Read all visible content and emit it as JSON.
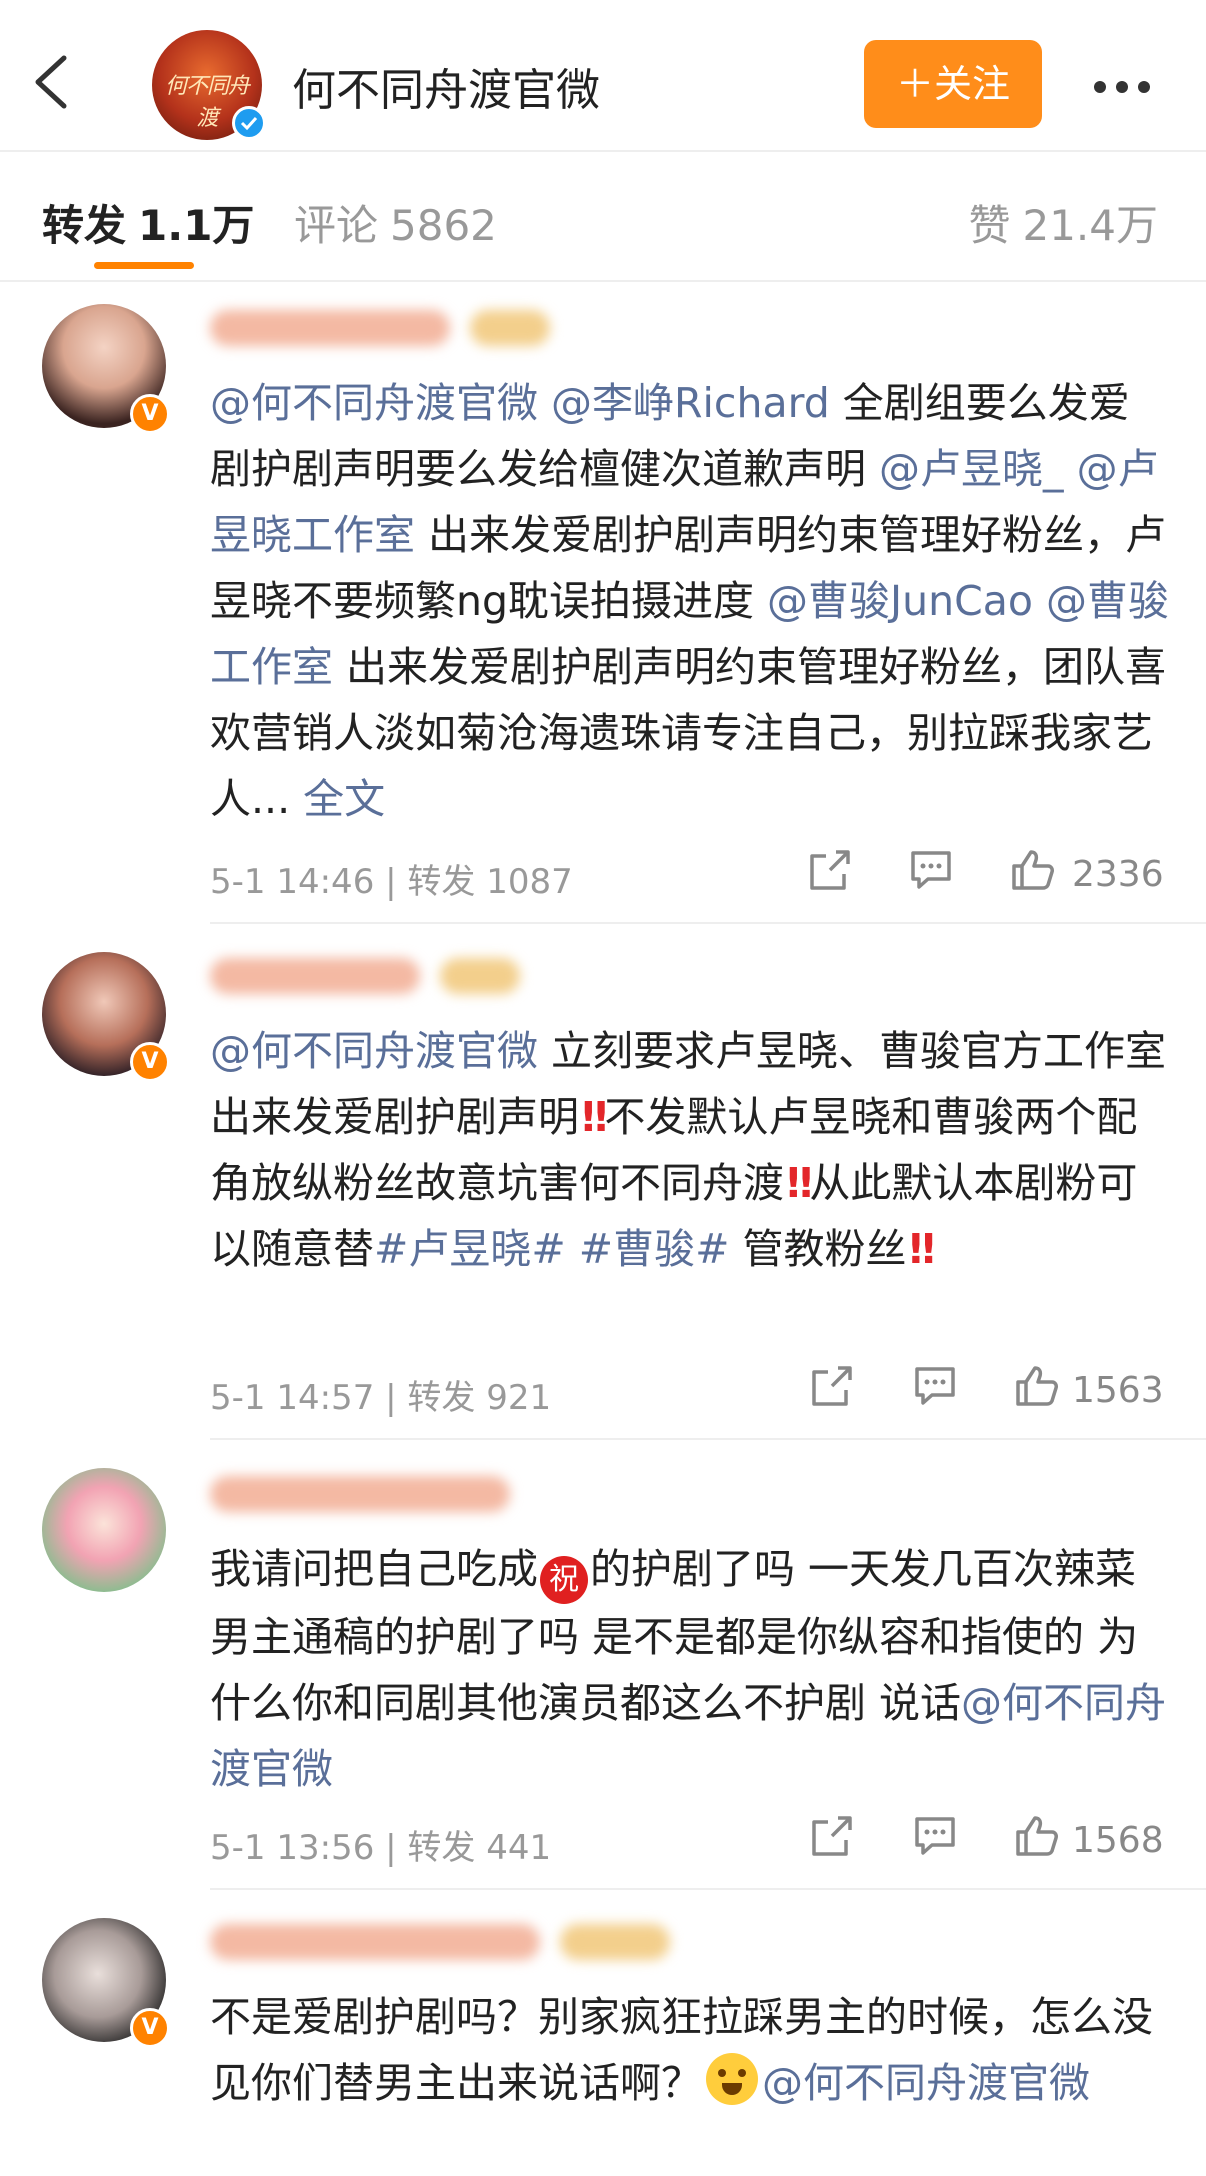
{
  "header": {
    "account_name": "何不同舟渡官微",
    "avatar_text": "何不同舟渡",
    "follow_label": "＋关注"
  },
  "tabs": {
    "repost_label": "转发",
    "repost_count": "1.1万",
    "comment_label": "评论",
    "comment_count": "5862",
    "likes_label": "赞",
    "likes_count": "21.4万"
  },
  "comments": [
    {
      "parts": [
        {
          "type": "mention",
          "text": "@何不同舟渡官微"
        },
        {
          "type": "text",
          "text": " "
        },
        {
          "type": "mention",
          "text": "@李峥Richard"
        },
        {
          "type": "text",
          "text": " 全剧组要么发爱剧护剧声明要么发给檀健次道歉声明 "
        },
        {
          "type": "mention",
          "text": "@卢昱晓_"
        },
        {
          "type": "text",
          "text": " "
        },
        {
          "type": "mention",
          "text": "@卢昱晓工作室"
        },
        {
          "type": "text",
          "text": " 出来发爱剧护剧声明约束管理好粉丝，卢昱晓不要频繁ng耽误拍摄进度 "
        },
        {
          "type": "mention",
          "text": "@曹骏JunCao"
        },
        {
          "type": "text",
          "text": " "
        },
        {
          "type": "mention",
          "text": "@曹骏工作室"
        },
        {
          "type": "text",
          "text": " 出来发爱剧护剧声明约束管理好粉丝，团队喜欢营销人淡如菊沧海遗珠请专注自己，别拉踩我家艺人... "
        },
        {
          "type": "fulltext",
          "text": "全文"
        }
      ],
      "time": "5-1 14:46",
      "repost_label": "转发",
      "repost_count": "1087",
      "likes": "2336"
    },
    {
      "parts": [
        {
          "type": "mention",
          "text": "@何不同舟渡官微"
        },
        {
          "type": "text",
          "text": " 立刻要求卢昱晓、曹骏官方工作室出来发爱剧护剧声明"
        },
        {
          "type": "bang",
          "text": "!!"
        },
        {
          "type": "text",
          "text": "不发默认卢昱晓和曹骏两个配角放纵粉丝故意坑害何不同舟渡"
        },
        {
          "type": "bang",
          "text": "!!"
        },
        {
          "type": "text",
          "text": "从此默认本剧粉可以随意替"
        },
        {
          "type": "topic",
          "text": "#卢昱晓#"
        },
        {
          "type": "text",
          "text": " "
        },
        {
          "type": "topic",
          "text": "#曹骏#"
        },
        {
          "type": "text",
          "text": " 管教粉丝"
        },
        {
          "type": "bang",
          "text": "!!"
        }
      ],
      "time": "5-1 14:57",
      "repost_label": "转发",
      "repost_count": "921",
      "likes": "1563"
    },
    {
      "parts": [
        {
          "type": "text",
          "text": "我请问把自己吃成"
        },
        {
          "type": "zhu",
          "text": "祝"
        },
        {
          "type": "text",
          "text": "的护剧了吗 一天发几百次辣菜男主通稿的护剧了吗 是不是都是你纵容和指使的 为什么你和同剧其他演员都这么不护剧 说话"
        },
        {
          "type": "mention",
          "text": "@何不同舟渡官微"
        }
      ],
      "time": "5-1 13:56",
      "repost_label": "转发",
      "repost_count": "441",
      "likes": "1568"
    },
    {
      "parts": [
        {
          "type": "text",
          "text": "不是爱剧护剧吗？别家疯狂拉踩男主的时候，怎么没见你们替男主出来说话啊？"
        },
        {
          "type": "face",
          "text": ""
        },
        {
          "type": "mention",
          "text": "@何不同舟渡官微"
        }
      ]
    }
  ],
  "colors": {
    "accent_orange": "#ff8d1a",
    "link_blue": "#5a6f99",
    "verified_blue": "#1e9cf0",
    "vip_orange": "#ff8200"
  },
  "icons": [
    "back-arrow-icon",
    "more-icon",
    "verified-icon",
    "v-badge-icon",
    "share-icon",
    "comment-icon",
    "like-icon"
  ]
}
